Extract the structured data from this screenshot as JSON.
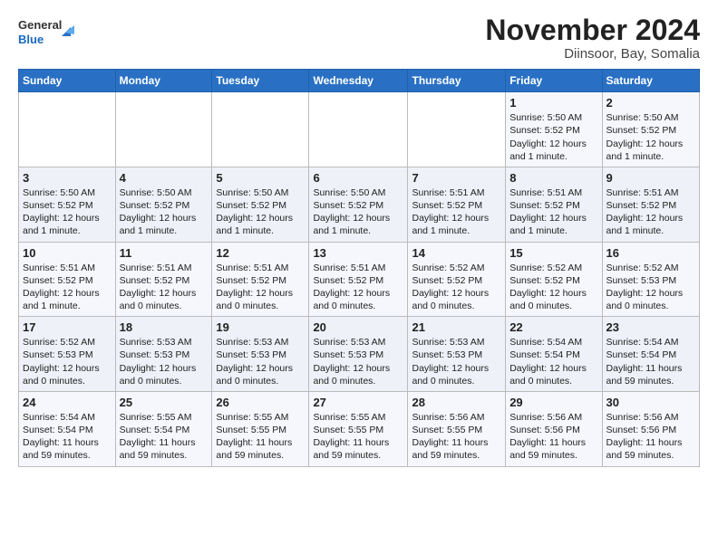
{
  "header": {
    "logo_line1": "General",
    "logo_line2": "Blue",
    "title": "November 2024",
    "subtitle": "Diinsoor, Bay, Somalia"
  },
  "calendar": {
    "days_of_week": [
      "Sunday",
      "Monday",
      "Tuesday",
      "Wednesday",
      "Thursday",
      "Friday",
      "Saturday"
    ],
    "weeks": [
      [
        {
          "day": "",
          "info": ""
        },
        {
          "day": "",
          "info": ""
        },
        {
          "day": "",
          "info": ""
        },
        {
          "day": "",
          "info": ""
        },
        {
          "day": "",
          "info": ""
        },
        {
          "day": "1",
          "info": "Sunrise: 5:50 AM\nSunset: 5:52 PM\nDaylight: 12 hours and 1 minute."
        },
        {
          "day": "2",
          "info": "Sunrise: 5:50 AM\nSunset: 5:52 PM\nDaylight: 12 hours and 1 minute."
        }
      ],
      [
        {
          "day": "3",
          "info": "Sunrise: 5:50 AM\nSunset: 5:52 PM\nDaylight: 12 hours and 1 minute."
        },
        {
          "day": "4",
          "info": "Sunrise: 5:50 AM\nSunset: 5:52 PM\nDaylight: 12 hours and 1 minute."
        },
        {
          "day": "5",
          "info": "Sunrise: 5:50 AM\nSunset: 5:52 PM\nDaylight: 12 hours and 1 minute."
        },
        {
          "day": "6",
          "info": "Sunrise: 5:50 AM\nSunset: 5:52 PM\nDaylight: 12 hours and 1 minute."
        },
        {
          "day": "7",
          "info": "Sunrise: 5:51 AM\nSunset: 5:52 PM\nDaylight: 12 hours and 1 minute."
        },
        {
          "day": "8",
          "info": "Sunrise: 5:51 AM\nSunset: 5:52 PM\nDaylight: 12 hours and 1 minute."
        },
        {
          "day": "9",
          "info": "Sunrise: 5:51 AM\nSunset: 5:52 PM\nDaylight: 12 hours and 1 minute."
        }
      ],
      [
        {
          "day": "10",
          "info": "Sunrise: 5:51 AM\nSunset: 5:52 PM\nDaylight: 12 hours and 1 minute."
        },
        {
          "day": "11",
          "info": "Sunrise: 5:51 AM\nSunset: 5:52 PM\nDaylight: 12 hours and 0 minutes."
        },
        {
          "day": "12",
          "info": "Sunrise: 5:51 AM\nSunset: 5:52 PM\nDaylight: 12 hours and 0 minutes."
        },
        {
          "day": "13",
          "info": "Sunrise: 5:51 AM\nSunset: 5:52 PM\nDaylight: 12 hours and 0 minutes."
        },
        {
          "day": "14",
          "info": "Sunrise: 5:52 AM\nSunset: 5:52 PM\nDaylight: 12 hours and 0 minutes."
        },
        {
          "day": "15",
          "info": "Sunrise: 5:52 AM\nSunset: 5:52 PM\nDaylight: 12 hours and 0 minutes."
        },
        {
          "day": "16",
          "info": "Sunrise: 5:52 AM\nSunset: 5:53 PM\nDaylight: 12 hours and 0 minutes."
        }
      ],
      [
        {
          "day": "17",
          "info": "Sunrise: 5:52 AM\nSunset: 5:53 PM\nDaylight: 12 hours and 0 minutes."
        },
        {
          "day": "18",
          "info": "Sunrise: 5:53 AM\nSunset: 5:53 PM\nDaylight: 12 hours and 0 minutes."
        },
        {
          "day": "19",
          "info": "Sunrise: 5:53 AM\nSunset: 5:53 PM\nDaylight: 12 hours and 0 minutes."
        },
        {
          "day": "20",
          "info": "Sunrise: 5:53 AM\nSunset: 5:53 PM\nDaylight: 12 hours and 0 minutes."
        },
        {
          "day": "21",
          "info": "Sunrise: 5:53 AM\nSunset: 5:53 PM\nDaylight: 12 hours and 0 minutes."
        },
        {
          "day": "22",
          "info": "Sunrise: 5:54 AM\nSunset: 5:54 PM\nDaylight: 12 hours and 0 minutes."
        },
        {
          "day": "23",
          "info": "Sunrise: 5:54 AM\nSunset: 5:54 PM\nDaylight: 11 hours and 59 minutes."
        }
      ],
      [
        {
          "day": "24",
          "info": "Sunrise: 5:54 AM\nSunset: 5:54 PM\nDaylight: 11 hours and 59 minutes."
        },
        {
          "day": "25",
          "info": "Sunrise: 5:55 AM\nSunset: 5:54 PM\nDaylight: 11 hours and 59 minutes."
        },
        {
          "day": "26",
          "info": "Sunrise: 5:55 AM\nSunset: 5:55 PM\nDaylight: 11 hours and 59 minutes."
        },
        {
          "day": "27",
          "info": "Sunrise: 5:55 AM\nSunset: 5:55 PM\nDaylight: 11 hours and 59 minutes."
        },
        {
          "day": "28",
          "info": "Sunrise: 5:56 AM\nSunset: 5:55 PM\nDaylight: 11 hours and 59 minutes."
        },
        {
          "day": "29",
          "info": "Sunrise: 5:56 AM\nSunset: 5:56 PM\nDaylight: 11 hours and 59 minutes."
        },
        {
          "day": "30",
          "info": "Sunrise: 5:56 AM\nSunset: 5:56 PM\nDaylight: 11 hours and 59 minutes."
        }
      ]
    ]
  }
}
